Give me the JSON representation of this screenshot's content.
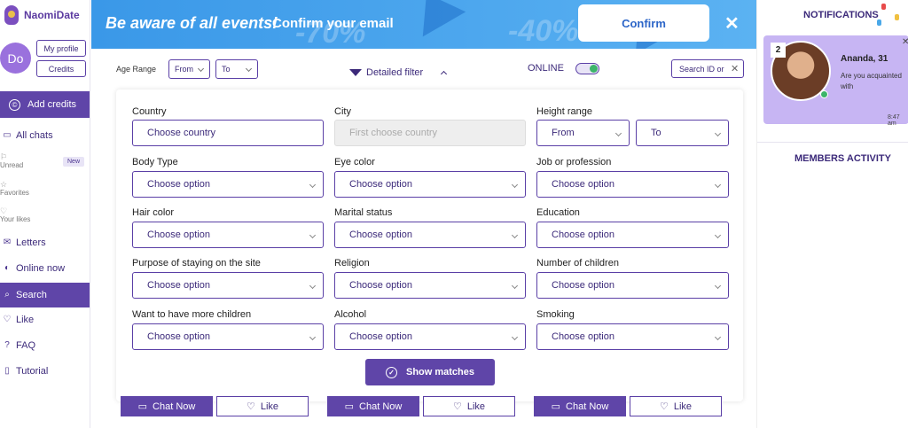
{
  "app": {
    "name": "NaomiDate"
  },
  "user": {
    "initials": "Do"
  },
  "sidebar": {
    "my_profile": "My profile",
    "credits": "Credits",
    "add_credits": "Add credits",
    "all_chats": "All chats",
    "unread": "Unread",
    "new_badge": "New",
    "favorites": "Favorites",
    "your_likes": "Your likes",
    "letters": "Letters",
    "online_now": "Online now",
    "search": "Search",
    "like": "Like",
    "faq": "FAQ",
    "tutorial": "Tutorial"
  },
  "banner": {
    "headline": "Be aware of all events!",
    "subline": "Confirm your email",
    "confirm_label": "Confirm",
    "close": "✕",
    "deco1": "-70%",
    "deco2": "-40%"
  },
  "filterbar": {
    "age_range_label": "Age Range",
    "age_from": "From",
    "age_to": "To",
    "detailed_filter": "Detailed filter",
    "online_label": "ONLINE",
    "online_on": true,
    "search_id_placeholder": "Search ID or",
    "search_clear": "✕"
  },
  "filters": {
    "country": {
      "label": "Country",
      "value": "Choose country"
    },
    "city": {
      "label": "City",
      "value": "First choose country"
    },
    "height": {
      "label": "Height range",
      "from": "From",
      "to": "To"
    },
    "body_type": {
      "label": "Body Type",
      "value": "Choose option"
    },
    "eye_color": {
      "label": "Eye color",
      "value": "Choose option"
    },
    "job": {
      "label": "Job or profession",
      "value": "Choose option"
    },
    "hair_color": {
      "label": "Hair color",
      "value": "Choose option"
    },
    "marital": {
      "label": "Marital status",
      "value": "Choose option"
    },
    "education": {
      "label": "Education",
      "value": "Choose option"
    },
    "purpose": {
      "label": "Purpose of staying on the site",
      "value": "Choose option"
    },
    "religion": {
      "label": "Religion",
      "value": "Choose option"
    },
    "children": {
      "label": "Number of children",
      "value": "Choose option"
    },
    "more_children": {
      "label": "Want to have more children",
      "value": "Choose option"
    },
    "alcohol": {
      "label": "Alcohol",
      "value": "Choose option"
    },
    "smoking": {
      "label": "Smoking",
      "value": "Choose option"
    },
    "show_matches": "Show matches"
  },
  "cards": {
    "chat_now": "Chat Now",
    "like": "Like"
  },
  "notifications": {
    "title": "NOTIFICATIONS",
    "count": "2",
    "name": "Ananda, 31",
    "message": "Are you acquainted with",
    "time": "8:47 am",
    "close": "✕"
  },
  "members_activity": {
    "title": "MEMBERS ACTIVITY"
  },
  "colors": {
    "primary": "#5f45a8",
    "banner": "#3a98e8",
    "online": "#3cb56a",
    "notif_card": "#c7b5f3"
  }
}
